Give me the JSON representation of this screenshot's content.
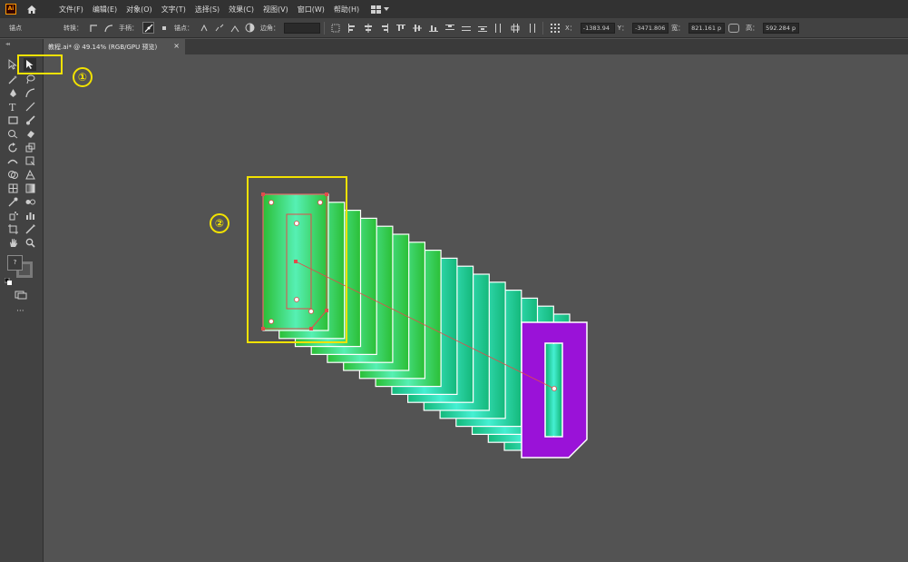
{
  "menu": {
    "items": [
      "文件(F)",
      "编辑(E)",
      "对象(O)",
      "文字(T)",
      "选择(S)",
      "效果(C)",
      "视图(V)",
      "窗口(W)",
      "帮助(H)"
    ]
  },
  "control": {
    "anchor_label": "锚点",
    "convert_label": "转换：",
    "handle_label": "手柄：",
    "anchor_label2": "锚点：",
    "corner_label": "边角：",
    "x_label": "X：",
    "x_value": "-1383.94",
    "y_label": "Y：",
    "y_value": "-3471.806",
    "w_label": "宽：",
    "w_value": "821.161 p",
    "h_label": "高：",
    "h_value": "592.284 p"
  },
  "tab": {
    "title": "教程.ai* @ 49.14% (RGB/GPU 预览)",
    "close": "×"
  },
  "toolbar": {
    "fill_stroke_label": "?",
    "more": "···"
  },
  "annotations": {
    "step1": "①",
    "step2": "②"
  },
  "colors": {
    "highlight": "#f2e200",
    "green_dark": "#3ac63c",
    "green_light": "#3de6c2",
    "purple": "#9a12d8",
    "selection_red": "#e24b4b"
  },
  "icons": [
    "ai-logo-icon",
    "home-icon",
    "workspace-icon",
    "selection-tool-icon",
    "direct-selection-icon"
  ]
}
